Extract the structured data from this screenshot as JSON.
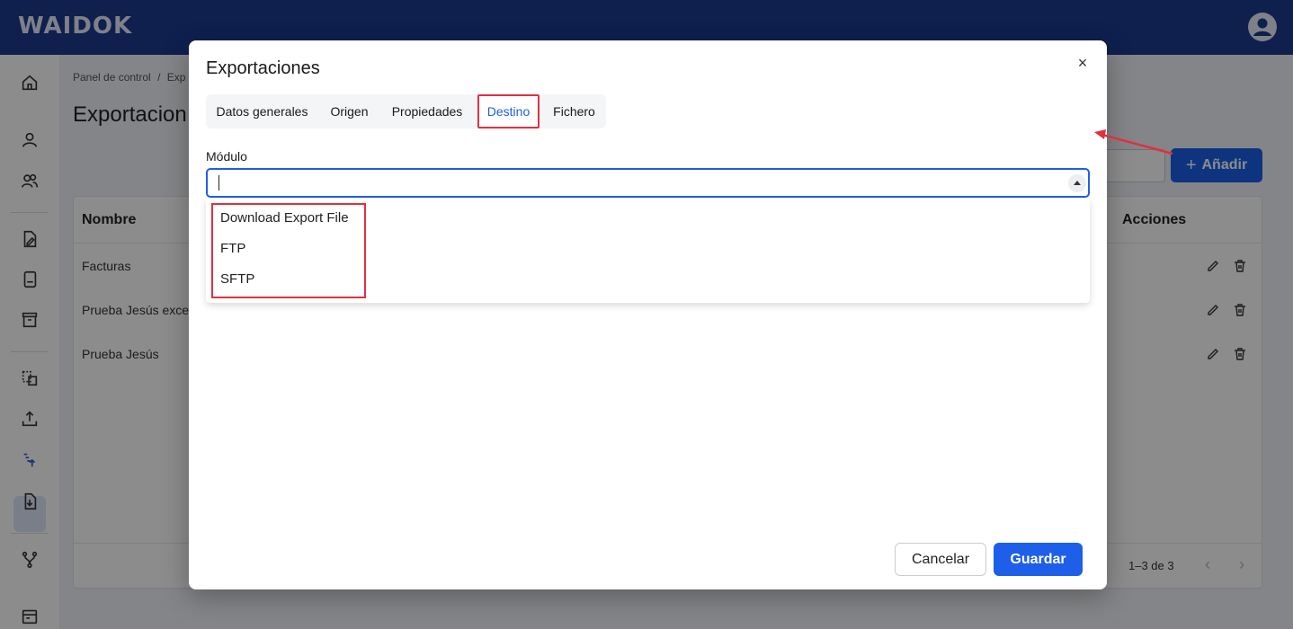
{
  "app": {
    "logo": "WAIDOK"
  },
  "header": {
    "avatar_icon": "user-circle-icon"
  },
  "sidebar": {
    "items": [
      {
        "icon": "home-icon"
      },
      {
        "icon": "user-icon"
      },
      {
        "icon": "users-icon"
      },
      {
        "icon": "document-edit-icon"
      },
      {
        "icon": "file-icon"
      },
      {
        "icon": "archive-icon"
      },
      {
        "icon": "transfer-icon"
      },
      {
        "icon": "upload-icon"
      },
      {
        "icon": "export-list-icon",
        "active": true
      },
      {
        "icon": "download-icon"
      },
      {
        "icon": "workflow-icon"
      },
      {
        "icon": "calendar-icon"
      }
    ]
  },
  "page": {
    "breadcrumb_home": "Panel de control",
    "breadcrumb_sep": "/",
    "breadcrumb_current": "Exp",
    "title": "Exportacion",
    "add_button": "Añadir",
    "add_icon": "+"
  },
  "table": {
    "headers": {
      "name": "Nombre",
      "actions": "Acciones"
    },
    "rows": [
      {
        "name": "Facturas"
      },
      {
        "name": "Prueba Jesús exce"
      },
      {
        "name": "Prueba Jesús"
      }
    ],
    "pagination": "1–3 de 3",
    "prev": "‹",
    "next": "›"
  },
  "dialog": {
    "title": "Exportaciones",
    "close": "×",
    "tabs": [
      {
        "label": "Datos generales"
      },
      {
        "label": "Origen"
      },
      {
        "label": "Propiedades"
      },
      {
        "label": "Destino",
        "active": true
      },
      {
        "label": "Fichero"
      }
    ],
    "field_label": "Módulo",
    "select_value": "",
    "options": [
      "Download Export File",
      "FTP",
      "SFTP"
    ],
    "cancel_label": "Cancelar",
    "save_label": "Guardar"
  },
  "colors": {
    "primary": "#1d5fe8",
    "header": "#1c3a8f",
    "highlight": "#e03040"
  }
}
